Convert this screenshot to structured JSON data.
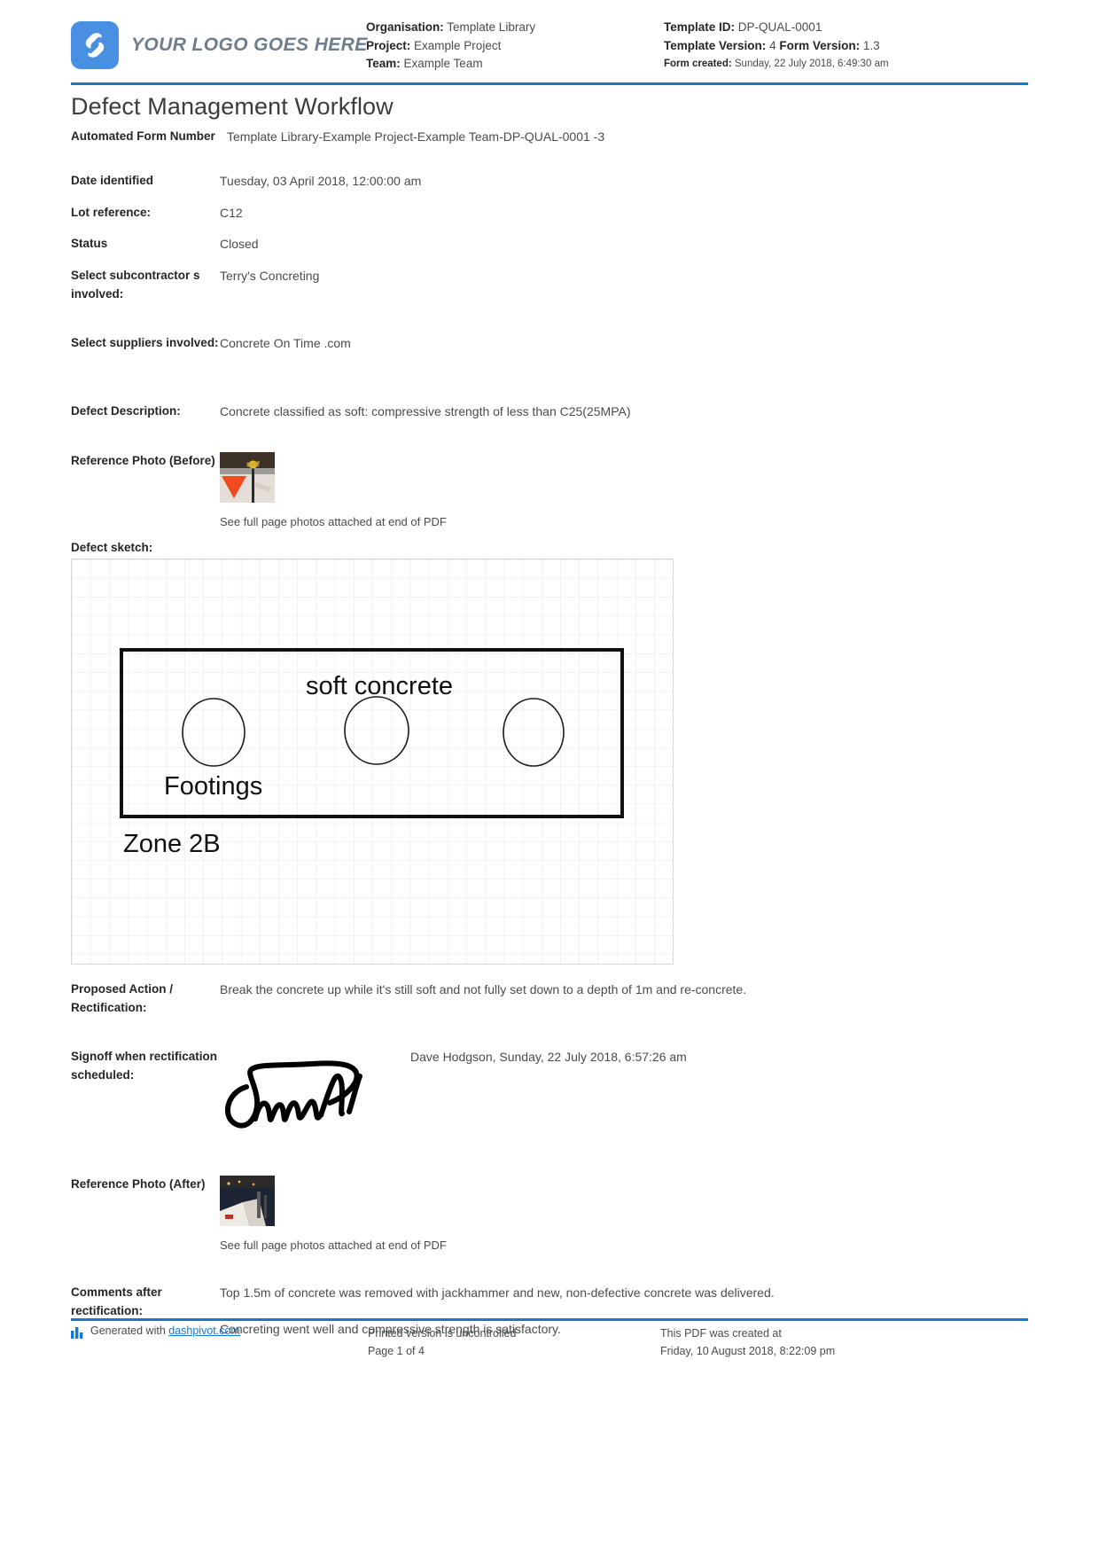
{
  "header": {
    "logo_text": "YOUR LOGO GOES HERE",
    "left_meta": [
      {
        "label": "Organisation:",
        "value": "Template Library"
      },
      {
        "label": "Project:",
        "value": "Example Project"
      },
      {
        "label": "Team:",
        "value": "Example Team"
      }
    ],
    "right_meta": {
      "template_id_label": "Template ID:",
      "template_id_value": "DP-QUAL-0001",
      "template_version_label": "Template Version:",
      "template_version_value": "4",
      "form_version_label": "Form Version:",
      "form_version_value": "1.3",
      "form_created_label": "Form created:",
      "form_created_value": "Sunday, 22 July 2018, 6:49:30 am"
    },
    "accent_color": "#1479d1",
    "logo_color": "#4a90e2"
  },
  "title": "Defect Management Workflow",
  "fields": {
    "automated_form_number": {
      "label": "Automated Form Number",
      "value": "Template Library-Example Project-Example Team-DP-QUAL-0001   -3"
    },
    "date_identified": {
      "label": "Date identified",
      "value": "Tuesday, 03 April 2018, 12:00:00 am"
    },
    "lot_reference": {
      "label": "Lot reference:",
      "value": "C12"
    },
    "status": {
      "label": "Status",
      "value": "Closed"
    },
    "subcontractors": {
      "label": "Select subcontractor s involved:",
      "value": "Terry's Concreting"
    },
    "suppliers": {
      "label": "Select suppliers involved:",
      "value": "Concrete On Time .com"
    },
    "defect_description": {
      "label": "Defect Description:",
      "value": "Concrete classified as soft: compressive strength of less than C25(25MPA)"
    },
    "reference_photo_before": {
      "label": "Reference Photo (Before)",
      "note": "See full page photos attached at end of PDF"
    },
    "defect_sketch": {
      "label": "Defect sketch:"
    },
    "proposed_action": {
      "label": "Proposed Action / Rectification:",
      "value": "Break the concrete up while it's still soft and not fully set down to a depth of 1m and re-concrete."
    },
    "signoff": {
      "label": "Signoff when rectification scheduled:",
      "value": "Dave Hodgson, Sunday, 22 July 2018, 6:57:26 am"
    },
    "reference_photo_after": {
      "label": "Reference Photo (After)",
      "note": "See full page photos attached at end of PDF"
    },
    "comments_after_rectification": {
      "label": "Comments after rectification:",
      "line1": "Top 1.5m of concrete was removed with jackhammer and new, non-defective concrete was delivered.",
      "line2": "Concreting went well and compressive strength is satisfactory."
    }
  },
  "sketch": {
    "labels": {
      "soft_concrete": "soft concrete",
      "footings": "Footings",
      "zone": "Zone 2B"
    }
  },
  "footer": {
    "generated_prefix": "Generated with ",
    "generated_link": "dashpivot.com",
    "printed_line1": "Printed version is uncontrolled",
    "printed_line2": "Page 1 of 4",
    "created_line1": "This PDF was created at",
    "created_line2": "Friday, 10 August 2018, 8:22:09 pm"
  }
}
